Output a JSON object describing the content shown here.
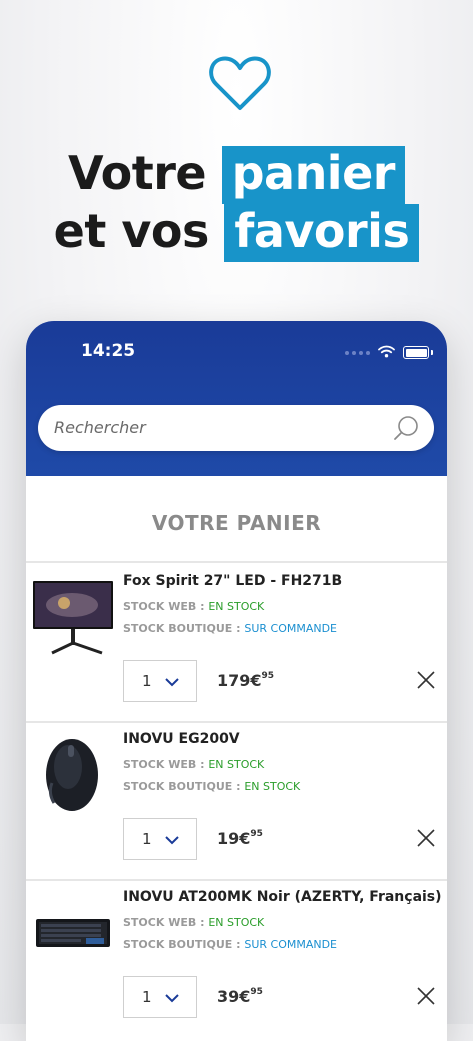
{
  "promo": {
    "line1_plain": "Votre",
    "line1_highlight": "panier",
    "line2_plain": "et vos",
    "line2_highlight": "favoris"
  },
  "status_bar": {
    "time": "14:25"
  },
  "search": {
    "placeholder": "Rechercher"
  },
  "cart": {
    "title": "VOTRE PANIER",
    "stock_web_label": "STOCK WEB :",
    "stock_shop_label": "STOCK BOUTIQUE :",
    "items": [
      {
        "name": "Fox Spirit 27\" LED - FH271B",
        "stock_web": "EN STOCK",
        "stock_shop": "SUR COMMANDE",
        "quantity": "1",
        "price_main": "179€",
        "price_cents": "95"
      },
      {
        "name": "INOVU EG200V",
        "stock_web": "EN STOCK",
        "stock_shop": "EN STOCK",
        "quantity": "1",
        "price_main": "19€",
        "price_cents": "95"
      },
      {
        "name": "INOVU AT200MK Noir (AZERTY, Français)",
        "stock_web": "EN STOCK",
        "stock_shop": "SUR COMMANDE",
        "quantity": "1",
        "price_main": "39€",
        "price_cents": "95"
      }
    ]
  },
  "colors": {
    "accent": "#1894c9",
    "header_blue": "#1a3b98",
    "in_stock": "#2a9d2a",
    "on_order": "#1b8fd0"
  }
}
